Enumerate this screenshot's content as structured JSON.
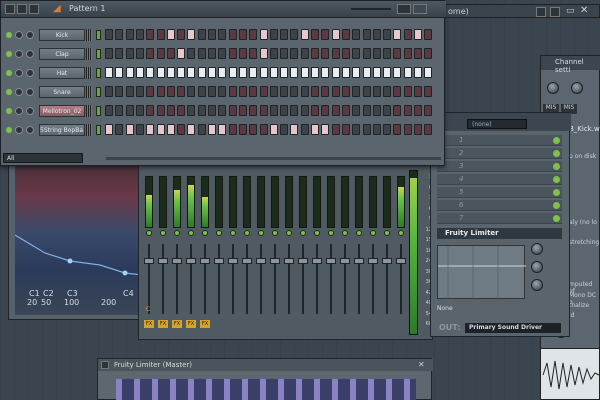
{
  "pattern_window": {
    "title": "Pattern 1",
    "filter_label": "All",
    "channels": [
      {
        "name": "Kick",
        "style": "gray",
        "steps": [
          0,
          0,
          0,
          0,
          0,
          0,
          1,
          0,
          1,
          0,
          0,
          0,
          0,
          0,
          0,
          1,
          0,
          0,
          0,
          1,
          0,
          0,
          1,
          0,
          0,
          0,
          0,
          0,
          1,
          0,
          1,
          0
        ]
      },
      {
        "name": "Clap",
        "style": "gray",
        "steps": [
          0,
          0,
          0,
          0,
          0,
          0,
          0,
          1,
          0,
          0,
          0,
          0,
          0,
          0,
          0,
          1,
          0,
          0,
          0,
          0,
          0,
          0,
          0,
          0,
          0,
          0,
          0,
          0,
          0,
          0,
          0,
          0
        ]
      },
      {
        "name": "Hat",
        "style": "gray",
        "steps": [
          1,
          1,
          1,
          1,
          1,
          1,
          1,
          1,
          1,
          1,
          1,
          1,
          1,
          1,
          1,
          1,
          1,
          1,
          1,
          1,
          1,
          1,
          1,
          1,
          1,
          1,
          1,
          1,
          1,
          1,
          1,
          1
        ]
      },
      {
        "name": "Snare",
        "style": "gray",
        "steps": [
          0,
          0,
          0,
          0,
          0,
          0,
          0,
          0,
          0,
          0,
          0,
          0,
          0,
          0,
          0,
          0,
          0,
          0,
          0,
          0,
          0,
          0,
          0,
          0,
          0,
          0,
          0,
          0,
          0,
          0,
          0,
          0
        ]
      },
      {
        "name": "Mellotron_02",
        "style": "pink",
        "steps": [
          0,
          0,
          0,
          0,
          0,
          0,
          0,
          0,
          0,
          0,
          0,
          0,
          0,
          0,
          0,
          0,
          0,
          0,
          0,
          0,
          0,
          0,
          0,
          0,
          0,
          0,
          0,
          0,
          0,
          0,
          0,
          0
        ]
      },
      {
        "name": "5String BopBa...",
        "style": "gray",
        "steps": [
          1,
          0,
          1,
          0,
          1,
          1,
          1,
          0,
          1,
          0,
          1,
          1,
          0,
          0,
          0,
          0,
          1,
          0,
          1,
          0,
          1,
          1,
          0,
          0,
          0,
          0,
          0,
          0,
          0,
          0,
          0,
          0
        ]
      }
    ]
  },
  "spectrum_window": {
    "labels": [
      "C1",
      "C2",
      "C3",
      "C4"
    ],
    "freq_labels": [
      "20",
      "50",
      "100",
      "200"
    ]
  },
  "channel_settings": {
    "title": "Channel setti",
    "tabs": [
      "MIS",
      "MIS"
    ],
    "file_label": "B_Kick.wa",
    "texts": [
      "p on disk",
      "aly (no lo",
      "stretching",
      "mputed ef",
      "Mono DC o",
      "tnalize",
      "ld"
    ]
  },
  "mixer": {
    "meter_levels": [
      0.65,
      0.0,
      0.75,
      0.85,
      0.6,
      0.0,
      0.0,
      0.0,
      0.0,
      0.0,
      0.0,
      0.0,
      0.0,
      0.0,
      0.0,
      0.0,
      0.0,
      0.0,
      0.8
    ],
    "fx_labels": [
      "FX",
      "FX",
      "FX",
      "FX",
      "FX"
    ],
    "fx_slot_marker": "C",
    "db_scale": [
      "3",
      "0",
      "3",
      "6",
      "9",
      "12",
      "15",
      "18",
      "24",
      "30",
      "36",
      "42",
      "48",
      "54",
      "60"
    ]
  },
  "effects_panel": {
    "selector": "(none)",
    "slots": [
      "1",
      "2",
      "3",
      "4",
      "5",
      "6",
      "7"
    ],
    "active_effect": "Fruity Limiter",
    "preset_label": "None",
    "out_label": "OUT:",
    "output_driver": "Primary Sound Driver"
  },
  "limiter_window": {
    "title": "Fruity Limiter (Master)"
  },
  "top_right": {
    "song_label": "ome)"
  },
  "colors": {
    "step_on": "#e6c7ca",
    "step_off": "#55363b",
    "step_on_hat": "#e8edf0",
    "step_off_hat": "#4a5258",
    "led_green": "#7fc24a"
  }
}
